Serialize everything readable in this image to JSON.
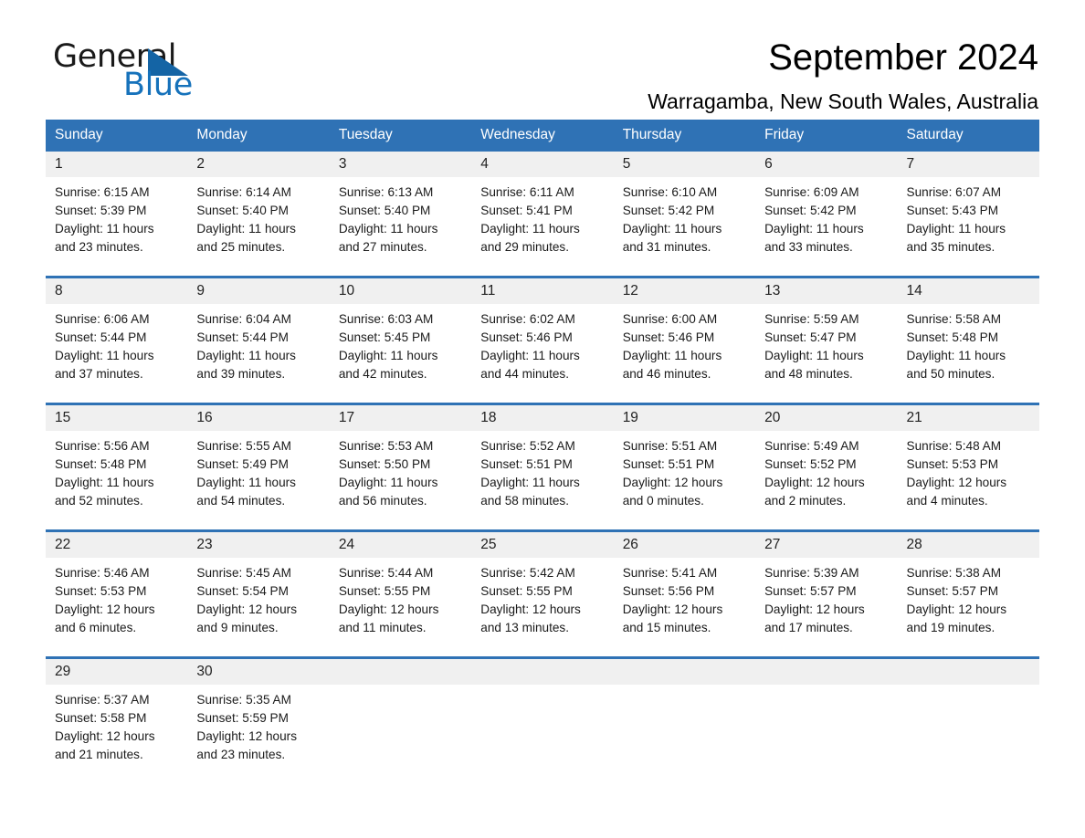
{
  "brand": {
    "name_part1": "General",
    "name_part2": "Blue",
    "triangle_color": "#1464a5",
    "blue_color": "#1672bb"
  },
  "header": {
    "title": "September 2024",
    "location": "Warragamba, New South Wales, Australia"
  },
  "theme": {
    "header_blue": "#2f72b5",
    "daynum_gray": "#f0f0f0",
    "text_black": "#1a1a1a"
  },
  "calendar": {
    "weekdays": [
      "Sunday",
      "Monday",
      "Tuesday",
      "Wednesday",
      "Thursday",
      "Friday",
      "Saturday"
    ],
    "weeks": [
      [
        {
          "day": "1",
          "sunrise": "Sunrise: 6:15 AM",
          "sunset": "Sunset: 5:39 PM",
          "daylight1": "Daylight: 11 hours",
          "daylight2": "and 23 minutes."
        },
        {
          "day": "2",
          "sunrise": "Sunrise: 6:14 AM",
          "sunset": "Sunset: 5:40 PM",
          "daylight1": "Daylight: 11 hours",
          "daylight2": "and 25 minutes."
        },
        {
          "day": "3",
          "sunrise": "Sunrise: 6:13 AM",
          "sunset": "Sunset: 5:40 PM",
          "daylight1": "Daylight: 11 hours",
          "daylight2": "and 27 minutes."
        },
        {
          "day": "4",
          "sunrise": "Sunrise: 6:11 AM",
          "sunset": "Sunset: 5:41 PM",
          "daylight1": "Daylight: 11 hours",
          "daylight2": "and 29 minutes."
        },
        {
          "day": "5",
          "sunrise": "Sunrise: 6:10 AM",
          "sunset": "Sunset: 5:42 PM",
          "daylight1": "Daylight: 11 hours",
          "daylight2": "and 31 minutes."
        },
        {
          "day": "6",
          "sunrise": "Sunrise: 6:09 AM",
          "sunset": "Sunset: 5:42 PM",
          "daylight1": "Daylight: 11 hours",
          "daylight2": "and 33 minutes."
        },
        {
          "day": "7",
          "sunrise": "Sunrise: 6:07 AM",
          "sunset": "Sunset: 5:43 PM",
          "daylight1": "Daylight: 11 hours",
          "daylight2": "and 35 minutes."
        }
      ],
      [
        {
          "day": "8",
          "sunrise": "Sunrise: 6:06 AM",
          "sunset": "Sunset: 5:44 PM",
          "daylight1": "Daylight: 11 hours",
          "daylight2": "and 37 minutes."
        },
        {
          "day": "9",
          "sunrise": "Sunrise: 6:04 AM",
          "sunset": "Sunset: 5:44 PM",
          "daylight1": "Daylight: 11 hours",
          "daylight2": "and 39 minutes."
        },
        {
          "day": "10",
          "sunrise": "Sunrise: 6:03 AM",
          "sunset": "Sunset: 5:45 PM",
          "daylight1": "Daylight: 11 hours",
          "daylight2": "and 42 minutes."
        },
        {
          "day": "11",
          "sunrise": "Sunrise: 6:02 AM",
          "sunset": "Sunset: 5:46 PM",
          "daylight1": "Daylight: 11 hours",
          "daylight2": "and 44 minutes."
        },
        {
          "day": "12",
          "sunrise": "Sunrise: 6:00 AM",
          "sunset": "Sunset: 5:46 PM",
          "daylight1": "Daylight: 11 hours",
          "daylight2": "and 46 minutes."
        },
        {
          "day": "13",
          "sunrise": "Sunrise: 5:59 AM",
          "sunset": "Sunset: 5:47 PM",
          "daylight1": "Daylight: 11 hours",
          "daylight2": "and 48 minutes."
        },
        {
          "day": "14",
          "sunrise": "Sunrise: 5:58 AM",
          "sunset": "Sunset: 5:48 PM",
          "daylight1": "Daylight: 11 hours",
          "daylight2": "and 50 minutes."
        }
      ],
      [
        {
          "day": "15",
          "sunrise": "Sunrise: 5:56 AM",
          "sunset": "Sunset: 5:48 PM",
          "daylight1": "Daylight: 11 hours",
          "daylight2": "and 52 minutes."
        },
        {
          "day": "16",
          "sunrise": "Sunrise: 5:55 AM",
          "sunset": "Sunset: 5:49 PM",
          "daylight1": "Daylight: 11 hours",
          "daylight2": "and 54 minutes."
        },
        {
          "day": "17",
          "sunrise": "Sunrise: 5:53 AM",
          "sunset": "Sunset: 5:50 PM",
          "daylight1": "Daylight: 11 hours",
          "daylight2": "and 56 minutes."
        },
        {
          "day": "18",
          "sunrise": "Sunrise: 5:52 AM",
          "sunset": "Sunset: 5:51 PM",
          "daylight1": "Daylight: 11 hours",
          "daylight2": "and 58 minutes."
        },
        {
          "day": "19",
          "sunrise": "Sunrise: 5:51 AM",
          "sunset": "Sunset: 5:51 PM",
          "daylight1": "Daylight: 12 hours",
          "daylight2": "and 0 minutes."
        },
        {
          "day": "20",
          "sunrise": "Sunrise: 5:49 AM",
          "sunset": "Sunset: 5:52 PM",
          "daylight1": "Daylight: 12 hours",
          "daylight2": "and 2 minutes."
        },
        {
          "day": "21",
          "sunrise": "Sunrise: 5:48 AM",
          "sunset": "Sunset: 5:53 PM",
          "daylight1": "Daylight: 12 hours",
          "daylight2": "and 4 minutes."
        }
      ],
      [
        {
          "day": "22",
          "sunrise": "Sunrise: 5:46 AM",
          "sunset": "Sunset: 5:53 PM",
          "daylight1": "Daylight: 12 hours",
          "daylight2": "and 6 minutes."
        },
        {
          "day": "23",
          "sunrise": "Sunrise: 5:45 AM",
          "sunset": "Sunset: 5:54 PM",
          "daylight1": "Daylight: 12 hours",
          "daylight2": "and 9 minutes."
        },
        {
          "day": "24",
          "sunrise": "Sunrise: 5:44 AM",
          "sunset": "Sunset: 5:55 PM",
          "daylight1": "Daylight: 12 hours",
          "daylight2": "and 11 minutes."
        },
        {
          "day": "25",
          "sunrise": "Sunrise: 5:42 AM",
          "sunset": "Sunset: 5:55 PM",
          "daylight1": "Daylight: 12 hours",
          "daylight2": "and 13 minutes."
        },
        {
          "day": "26",
          "sunrise": "Sunrise: 5:41 AM",
          "sunset": "Sunset: 5:56 PM",
          "daylight1": "Daylight: 12 hours",
          "daylight2": "and 15 minutes."
        },
        {
          "day": "27",
          "sunrise": "Sunrise: 5:39 AM",
          "sunset": "Sunset: 5:57 PM",
          "daylight1": "Daylight: 12 hours",
          "daylight2": "and 17 minutes."
        },
        {
          "day": "28",
          "sunrise": "Sunrise: 5:38 AM",
          "sunset": "Sunset: 5:57 PM",
          "daylight1": "Daylight: 12 hours",
          "daylight2": "and 19 minutes."
        }
      ],
      [
        {
          "day": "29",
          "sunrise": "Sunrise: 5:37 AM",
          "sunset": "Sunset: 5:58 PM",
          "daylight1": "Daylight: 12 hours",
          "daylight2": "and 21 minutes."
        },
        {
          "day": "30",
          "sunrise": "Sunrise: 5:35 AM",
          "sunset": "Sunset: 5:59 PM",
          "daylight1": "Daylight: 12 hours",
          "daylight2": "and 23 minutes."
        },
        {
          "day": "",
          "sunrise": "",
          "sunset": "",
          "daylight1": "",
          "daylight2": ""
        },
        {
          "day": "",
          "sunrise": "",
          "sunset": "",
          "daylight1": "",
          "daylight2": ""
        },
        {
          "day": "",
          "sunrise": "",
          "sunset": "",
          "daylight1": "",
          "daylight2": ""
        },
        {
          "day": "",
          "sunrise": "",
          "sunset": "",
          "daylight1": "",
          "daylight2": ""
        },
        {
          "day": "",
          "sunrise": "",
          "sunset": "",
          "daylight1": "",
          "daylight2": ""
        }
      ]
    ]
  }
}
